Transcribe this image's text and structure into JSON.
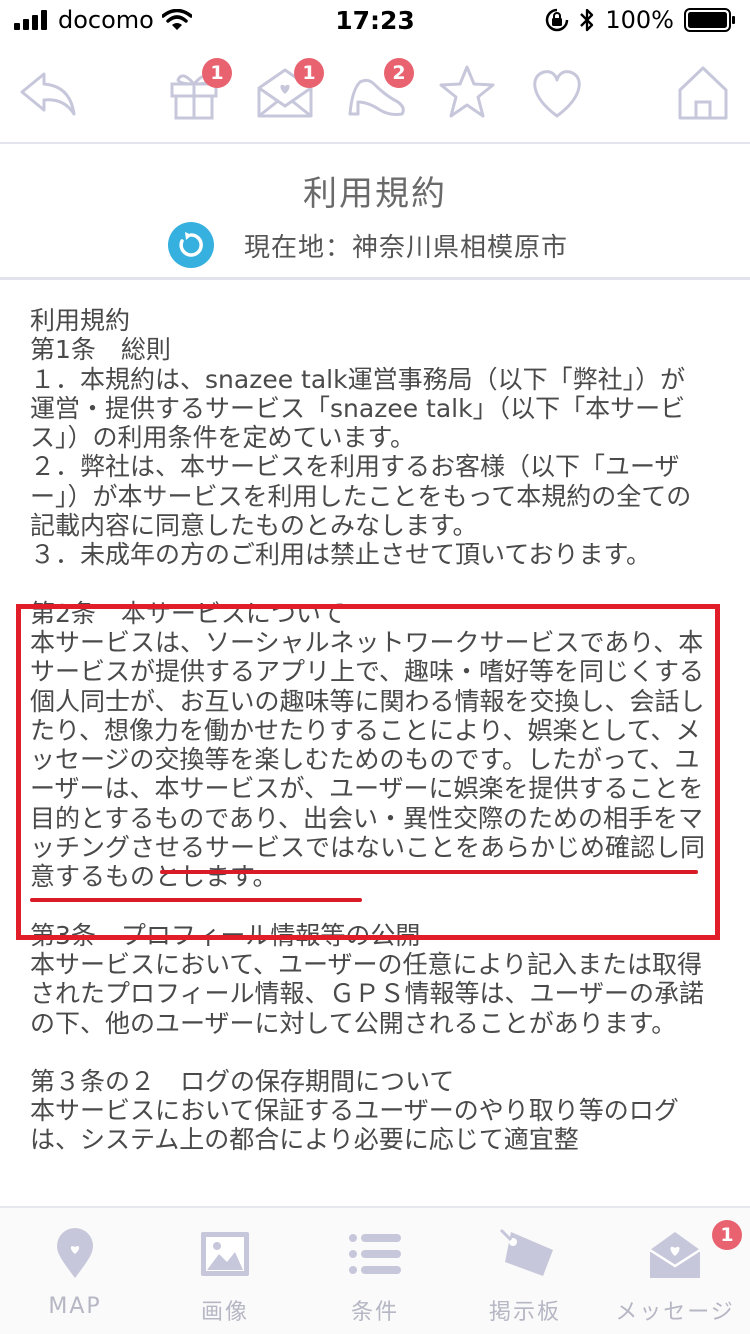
{
  "status_bar": {
    "carrier": "docomo",
    "time": "17:23",
    "battery": "100%"
  },
  "top_nav": {
    "badges": {
      "gift": "1",
      "mail": "1",
      "heel": "2"
    }
  },
  "header": {
    "title": "利用規約",
    "location": "現在地：神奈川県相模原市"
  },
  "terms": {
    "s1": "利用規約\n第1条　総則\n１．本規約は、snazee talk運営事務局（以下「弊社」）が運営・提供するサービス「snazee talk」（以下「本サービス」）の利用条件を定めています。\n２．弊社は、本サービスを利用するお客様（以下「ユーザー」）が本サービスを利用したことをもって本規約の全ての記載内容に同意したものとみなします。\n３．未成年の方のご利用は禁止させて頂いております。",
    "s2": "第2条　本サービスについて\n本サービスは、ソーシャルネットワークサービスであり、本サービスが提供するアプリ上で、趣味・嗜好等を同じくする個人同士が、お互いの趣味等に関わる情報を交換し、会話したり、想像力を働かせたりすることにより、娯楽として、メッセージの交換等を楽しむためのものです。したがって、ユーザーは、本サービスが、ユーザーに娯楽を提供することを目的とするものであり、出会い・異性交際のための相手をマッチングさせるサービスではないことをあらかじめ確認し同意するものとします。",
    "s3": "第3条　プロフィール情報等の公開\n本サービスにおいて、ユーザーの任意により記入または取得されたプロフィール情報、ＧＰＳ情報等は、ユーザーの承諾の下、他のユーザーに対して公開されることがあります。",
    "s4": "第３条の２　ログの保存期間について\n本サービスにおいて保証するユーザーのやり取り等のログは、システム上の都合により必要に応じて適宜整"
  },
  "tab_bar": {
    "tabs": [
      {
        "label": "MAP",
        "icon": "map-pin-icon"
      },
      {
        "label": "画像",
        "icon": "image-icon"
      },
      {
        "label": "条件",
        "icon": "list-icon"
      },
      {
        "label": "掲示板",
        "icon": "tag-icon"
      },
      {
        "label": "メッセージ",
        "icon": "mail-icon"
      }
    ],
    "message_badge": "1"
  },
  "colors": {
    "icon": "#c7c7db",
    "badge": "#e8636f",
    "highlight": "#e11d2a",
    "refresh": "#36b0df"
  }
}
